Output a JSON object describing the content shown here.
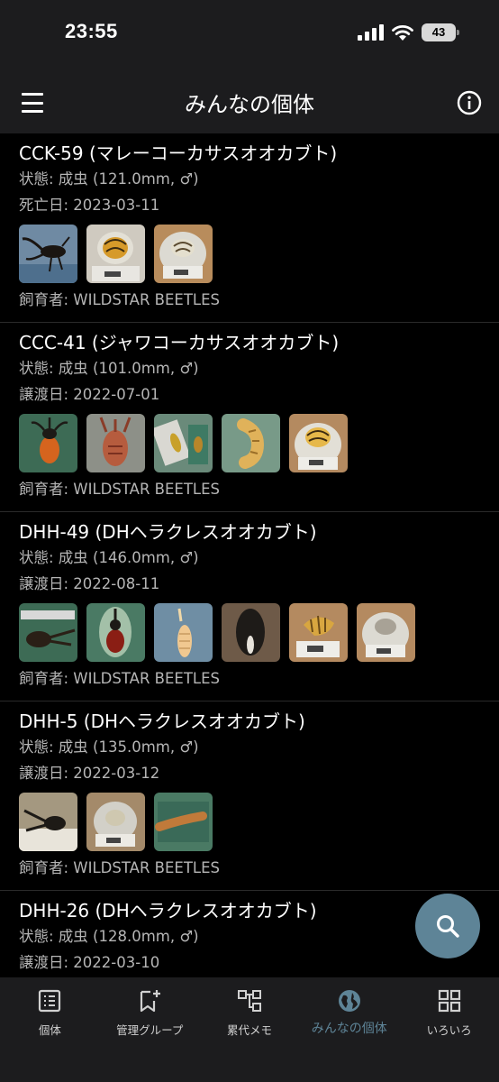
{
  "status_bar": {
    "time": "23:55",
    "battery": "43"
  },
  "app_bar": {
    "title": "みんなの個体"
  },
  "cards": [
    {
      "title": "CCK-59 (マレーコーカサスオオカブト)",
      "status": "状態: 成虫 (121.0mm, ♂)",
      "date": "死亡日: 2023-03-11",
      "owner": "飼育者: WILDSTAR BEETLES",
      "photo_count": 3
    },
    {
      "title": "CCC-41 (ジャワコーカサスオオカブト)",
      "status": "状態: 成虫 (101.0mm, ♂)",
      "date": "譲渡日: 2022-07-01",
      "owner": "飼育者: WILDSTAR BEETLES",
      "photo_count": 5
    },
    {
      "title": "DHH-49 (DHヘラクレスオオカブト)",
      "status": "状態: 成虫 (146.0mm, ♂)",
      "date": "譲渡日: 2022-08-11",
      "owner": "飼育者: WILDSTAR BEETLES",
      "photo_count": 6
    },
    {
      "title": "DHH-5 (DHヘラクレスオオカブト)",
      "status": "状態: 成虫 (135.0mm, ♂)",
      "date": "譲渡日: 2022-03-12",
      "owner": "飼育者: WILDSTAR BEETLES",
      "photo_count": 3
    },
    {
      "title": "DHH-26 (DHヘラクレスオオカブト)",
      "status": "状態: 成虫 (128.0mm, ♂)",
      "date": "譲渡日: 2022-03-10",
      "owner": "",
      "photo_count": 0
    }
  ],
  "bottom_nav": {
    "items": [
      {
        "label": "個体",
        "icon": "list-icon"
      },
      {
        "label": "管理グループ",
        "icon": "bookmark-add-icon"
      },
      {
        "label": "累代メモ",
        "icon": "lineage-icon"
      },
      {
        "label": "みんなの個体",
        "icon": "globe-icon",
        "active": true
      },
      {
        "label": "いろいろ",
        "icon": "grid-icon"
      }
    ]
  },
  "colors": {
    "accent": "#5e8497",
    "bar_bg": "#1c1c1e",
    "content_bg": "#000000"
  }
}
